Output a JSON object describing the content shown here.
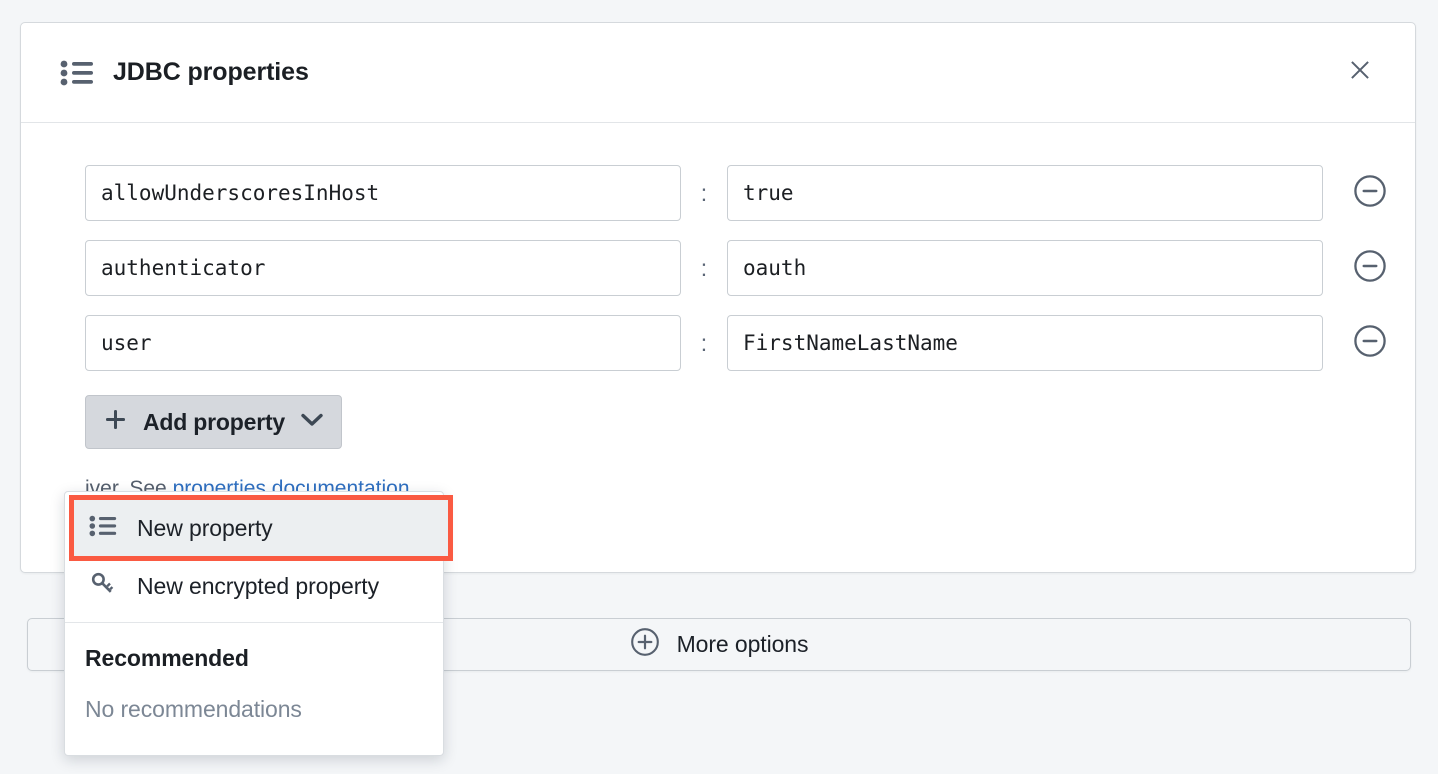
{
  "dialog": {
    "title": "JDBC properties",
    "title_icon": "list-icon",
    "close_icon": "close-icon"
  },
  "properties": {
    "separator": ":",
    "remove_icon": "minus-circle-icon",
    "rows": [
      {
        "key": "allowUnderscoresInHost",
        "value": "true"
      },
      {
        "key": "authenticator",
        "value": "oauth"
      },
      {
        "key": "user",
        "value": "FirstNameLastName"
      }
    ]
  },
  "add_property": {
    "label": "Add property",
    "plus_icon": "plus-icon",
    "chevron_icon": "chevron-down-icon"
  },
  "hint": {
    "text": "iver. See ",
    "link_text": "properties documentation"
  },
  "more_options": {
    "label": "More options",
    "icon": "plus-circle-icon"
  },
  "dropdown": {
    "items": [
      {
        "label": "New property",
        "icon": "list-icon",
        "highlighted": true
      },
      {
        "label": "New encrypted property",
        "icon": "key-icon",
        "highlighted": false
      }
    ],
    "section_title": "Recommended",
    "empty_text": "No recommendations"
  },
  "colors": {
    "page_bg": "#f4f6f8",
    "card_bg": "#ffffff",
    "accent_highlight": "#fa5a42",
    "link": "#2f6fc0",
    "icon_slate": "#57616f",
    "button_bg": "#d5d8dd"
  }
}
